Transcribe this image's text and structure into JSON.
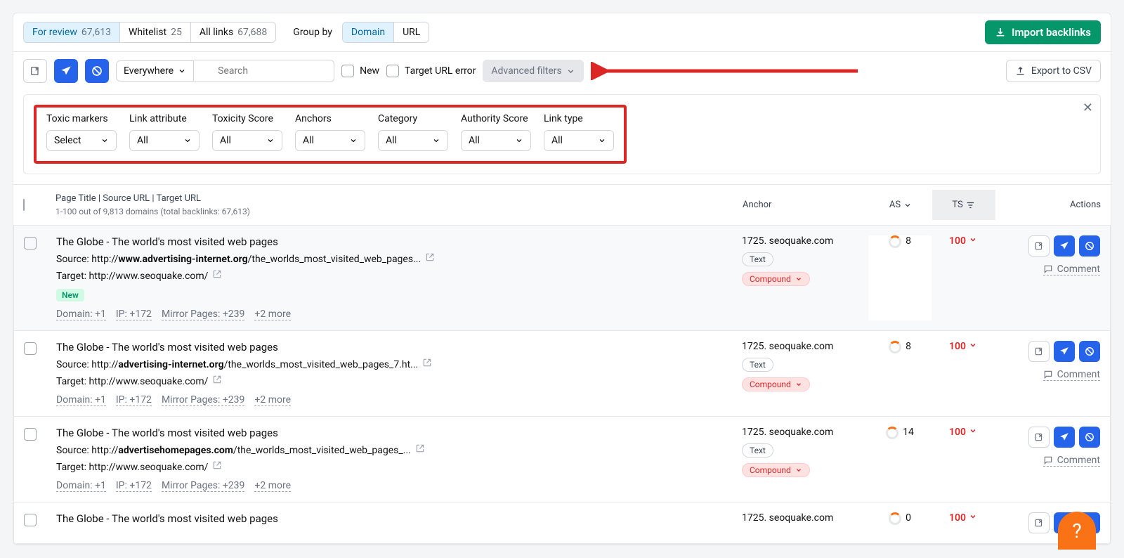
{
  "tabs": {
    "for_review": {
      "label": "For review",
      "count": "67,613"
    },
    "whitelist": {
      "label": "Whitelist",
      "count": "25"
    },
    "all_links": {
      "label": "All links",
      "count": "67,688"
    }
  },
  "group_by": {
    "label": "Group by",
    "domain": "Domain",
    "url": "URL"
  },
  "import_btn": "Import backlinks",
  "toolbar": {
    "everywhere": "Everywhere",
    "search_placeholder": "Search",
    "new": "New",
    "target_url_error": "Target URL error",
    "advanced_filters": "Advanced filters",
    "export": "Export to CSV"
  },
  "filters": [
    {
      "label": "Toxic markers",
      "value": "Select"
    },
    {
      "label": "Link attribute",
      "value": "All"
    },
    {
      "label": "Toxicity Score",
      "value": "All"
    },
    {
      "label": "Anchors",
      "value": "All"
    },
    {
      "label": "Category",
      "value": "All"
    },
    {
      "label": "Authority Score",
      "value": "All"
    },
    {
      "label": "Link type",
      "value": "All"
    }
  ],
  "table": {
    "header_title": "Page Title | Source URL | Target URL",
    "header_sub": "1-100 out of 9,813 domains (total backlinks: 67,613)",
    "col_anchor": "Anchor",
    "col_as": "AS",
    "col_ts": "TS",
    "col_actions": "Actions"
  },
  "rows": [
    {
      "highlight": true,
      "title": "The Globe - The world's most visited web pages",
      "src_prefix": "Source: ",
      "src_proto": "http://",
      "src_bold": "www.advertising-internet.org",
      "src_rest": "/the_worlds_most_visited_web_pages...",
      "tgt_prefix": "Target: ",
      "tgt": "http://www.seoquake.com/",
      "is_new": true,
      "new_label": "New",
      "meta": [
        "Domain: +1",
        "IP: +172",
        "Mirror Pages: +239",
        "+2 more"
      ],
      "anchor": "1725. seoquake.com",
      "anc_text": "Text",
      "anc_compound": "Compound",
      "as": "8",
      "ts": "100",
      "comment": "Comment"
    },
    {
      "highlight": false,
      "title": "The Globe - The world's most visited web pages",
      "src_prefix": "Source: ",
      "src_proto": "http://",
      "src_bold": "advertising-internet.org",
      "src_rest": "/the_worlds_most_visited_web_pages_7.ht...",
      "tgt_prefix": "Target: ",
      "tgt": "http://www.seoquake.com/",
      "is_new": false,
      "meta": [
        "Domain: +1",
        "IP: +172",
        "Mirror Pages: +239",
        "+2 more"
      ],
      "anchor": "1725. seoquake.com",
      "anc_text": "Text",
      "anc_compound": "Compound",
      "as": "8",
      "ts": "100",
      "comment": "Comment"
    },
    {
      "highlight": false,
      "title": "The Globe - The world's most visited web pages",
      "src_prefix": "Source: ",
      "src_proto": "http://",
      "src_bold": "advertisehomepages.com",
      "src_rest": "/the_worlds_most_visited_web_pages_...",
      "tgt_prefix": "Target: ",
      "tgt": "http://www.seoquake.com/",
      "is_new": false,
      "meta": [
        "Domain: +1",
        "IP: +172",
        "Mirror Pages: +239",
        "+2 more"
      ],
      "anchor": "1725. seoquake.com",
      "anc_text": "Text",
      "anc_compound": "Compound",
      "as": "14",
      "ts": "100",
      "comment": "Comment"
    },
    {
      "highlight": false,
      "title": "The Globe - The world's most visited web pages",
      "src_prefix": "",
      "src_proto": "",
      "src_bold": "",
      "src_rest": "",
      "tgt_prefix": "",
      "tgt": "",
      "is_new": false,
      "meta": [],
      "anchor": "1725. seoquake.com",
      "anc_text": "",
      "anc_compound": "",
      "as": "0",
      "ts": "100",
      "comment": ""
    }
  ]
}
